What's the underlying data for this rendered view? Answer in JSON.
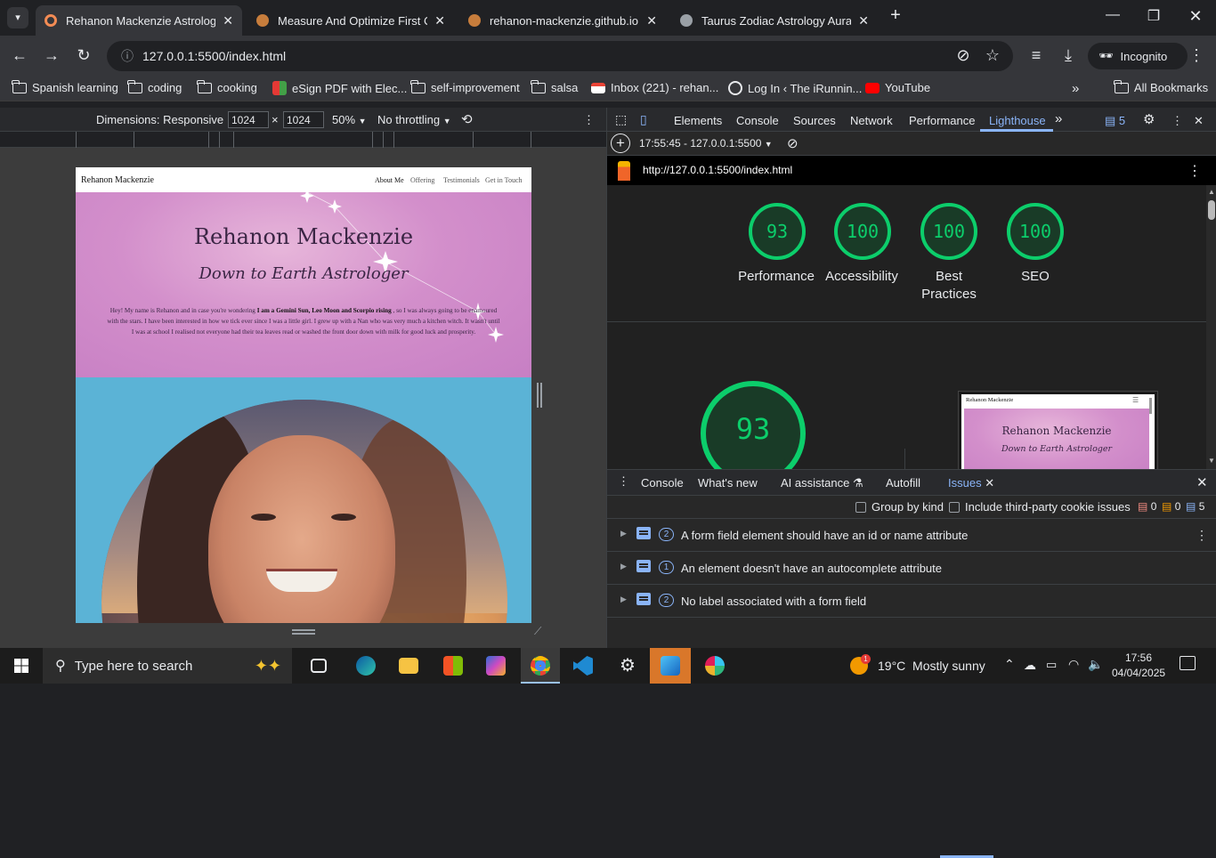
{
  "browser": {
    "tabs": [
      {
        "title": "Rehanon Mackenzie Astrology",
        "fav": "#f28b54"
      },
      {
        "title": "Measure And Optimize First Co",
        "fav": "#c77d3c"
      },
      {
        "title": "rehanon-mackenzie.github.io | Li",
        "fav": "#c77d3c"
      },
      {
        "title": "Taurus Zodiac Astrology Aura G",
        "fav": "#e8eaed"
      }
    ],
    "address": "127.0.0.1:5500/index.html",
    "incognito_label": "Incognito",
    "bookmarks": [
      {
        "label": "Spanish learning",
        "type": "folder"
      },
      {
        "label": "coding",
        "type": "folder"
      },
      {
        "label": "cooking",
        "type": "folder"
      },
      {
        "label": "eSign PDF with Elec...",
        "type": "site"
      },
      {
        "label": "self-improvement",
        "type": "folder"
      },
      {
        "label": "salsa",
        "type": "folder"
      },
      {
        "label": "Inbox (221) - rehan...",
        "type": "gmail"
      },
      {
        "label": "Log In ‹ The iRunnin...",
        "type": "wp"
      },
      {
        "label": "YouTube",
        "type": "yt"
      }
    ],
    "all_bookmarks": "All Bookmarks"
  },
  "device_toolbar": {
    "dimensions_label": "Dimensions: Responsive",
    "width": "1024",
    "height": "1024",
    "times": "×",
    "zoom": "50%",
    "throttling": "No throttling"
  },
  "site": {
    "brand": "Rehanon Mackenzie",
    "nav": [
      "About Me",
      "Offering",
      "Testimonials",
      "Get in Touch"
    ],
    "hero_title": "Rehanon Mackenzie",
    "hero_subtitle": "Down to Earth Astrologer",
    "intro_before": "Hey! My name is Rehanon and in case you're wondering ",
    "intro_bold": "I am a Gemini Sun, Leo Moon and Scorpio rising",
    "intro_after": " , so I was always going to be enamoured with the stars. I have been interested in how we tick ever since I was a little girl. I grew up with a Nan who was very much a kitchen witch. It wasn't until I was at school I realised not everyone had their tea leaves read or washed the front door down with milk for good luck and prosperity."
  },
  "devtools": {
    "tabs": [
      "Elements",
      "Console",
      "Sources",
      "Network",
      "Performance",
      "Lighthouse"
    ],
    "issues_count": "5",
    "report_time": "17:55:45 - 127.0.0.1:5500",
    "report_url": "http://127.0.0.1:5500/index.html",
    "scores": [
      {
        "value": 93,
        "label": "Performance"
      },
      {
        "value": 100,
        "label": "Accessibility"
      },
      {
        "value": 100,
        "label": "Best Practices"
      },
      {
        "value": 100,
        "label": "SEO"
      }
    ],
    "big_score": 93,
    "thumb_brand": "Rehanon Mackenzie",
    "thumb_title": "Rehanon Mackenzie",
    "thumb_sub": "Down to Earth Astrologer",
    "drawer_tabs": [
      "Console",
      "What's new",
      "AI assistance",
      "Autofill",
      "Issues"
    ],
    "group_by_kind": "Group by kind",
    "third_party": "Include third-party cookie issues",
    "counts": {
      "errors": "0",
      "warnings": "0",
      "info": "5"
    },
    "issues": [
      {
        "count": "2",
        "text": "A form field element should have an id or name attribute"
      },
      {
        "count": "1",
        "text": "An element doesn't have an autocomplete attribute"
      },
      {
        "count": "2",
        "text": "No label associated with a form field"
      }
    ]
  },
  "taskbar": {
    "search_placeholder": "Type here to search",
    "weather": "19°C  Mostly sunny",
    "time": "17:56",
    "date": "04/04/2025",
    "weather_badge": "1"
  }
}
